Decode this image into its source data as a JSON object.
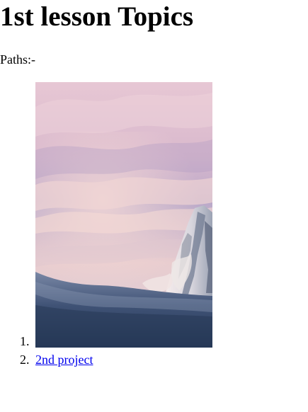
{
  "page": {
    "title": "1st lesson Topics",
    "paths_label": "Paths:-"
  },
  "topics": {
    "items": [
      {
        "marker": "1.",
        "type": "image",
        "image": "mountain-landscape-image"
      },
      {
        "marker": "2.",
        "type": "link",
        "label": "2nd project"
      }
    ]
  },
  "colors": {
    "link": "#0000ee",
    "text": "#000000",
    "background": "#ffffff"
  }
}
